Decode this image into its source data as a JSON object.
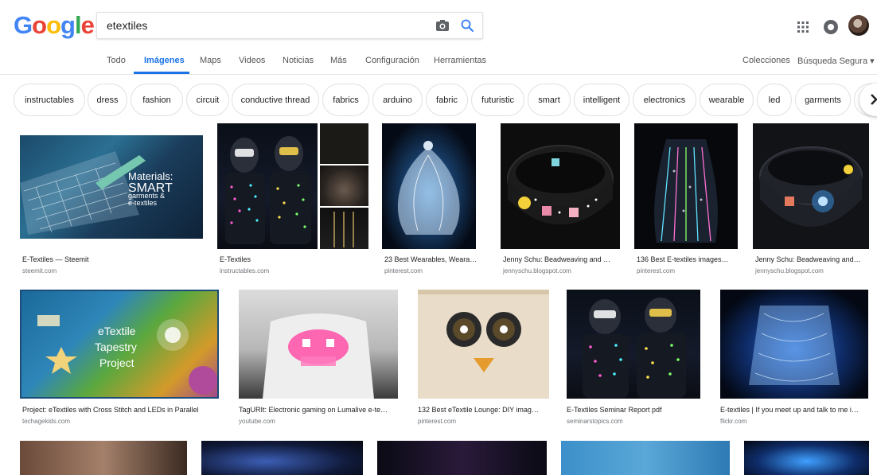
{
  "logo": {
    "text": "Google",
    "letters": [
      "G",
      "o",
      "o",
      "g",
      "l",
      "e"
    ]
  },
  "search": {
    "query": "etextiles",
    "placeholder": ""
  },
  "nav": {
    "tabs": [
      "Todo",
      "Imágenes",
      "Maps",
      "Videos",
      "Noticias",
      "Más",
      "Configuración",
      "Herramientas"
    ],
    "active_tab": "Imágenes",
    "collections": "Colecciones",
    "safe_search": "Búsqueda Segura ▾"
  },
  "chips": [
    "instructables",
    "dress",
    "fashion",
    "circuit",
    "conductive thread",
    "fabrics",
    "arduino",
    "fabric",
    "futuristic",
    "smart",
    "intelligent",
    "electronics",
    "wearable",
    "led",
    "garments"
  ],
  "results": [
    {
      "title": "E-Textiles — Steemit",
      "source": "steemit.com",
      "overlay": "Materials:",
      "overlay2": "SMART",
      "overlay3": "garments &",
      "overlay4": "e-textiles"
    },
    {
      "title": "E-Textiles",
      "source": "instructables.com"
    },
    {
      "title": "23 Best Wearables, Weara…",
      "source": "pinterest.com"
    },
    {
      "title": "Jenny Schu: Beadweaving and …",
      "source": "jennyschu.blogspot.com"
    },
    {
      "title": "136 Best E-textiles images…",
      "source": "pinterest.com"
    },
    {
      "title": "Jenny Schu: Beadweaving and…",
      "source": "jennyschu.blogspot.com"
    },
    {
      "title": "Project: eTextiles with Cross Stitch and LEDs in Parallel",
      "source": "techagekids.com",
      "overlay": "eTextile",
      "overlay2": "Tapestry",
      "overlay3": "Project"
    },
    {
      "title": "TagURIt: Electronic gaming on Lumalive e-te…",
      "source": "youtube.com"
    },
    {
      "title": "132 Best eTextile Lounge: DIY imag…",
      "source": "pinterest.com"
    },
    {
      "title": "E-Textiles Seminar Report pdf",
      "source": "seminarstopics.com"
    },
    {
      "title": "E-textiles | If you meet up and talk to me i…",
      "source": "flickr.com"
    }
  ],
  "colors": {
    "google_blue": "#4285f4",
    "google_red": "#ea4335",
    "google_yellow": "#fbbc05",
    "google_green": "#34a853",
    "active_tab": "#1a73e8"
  }
}
